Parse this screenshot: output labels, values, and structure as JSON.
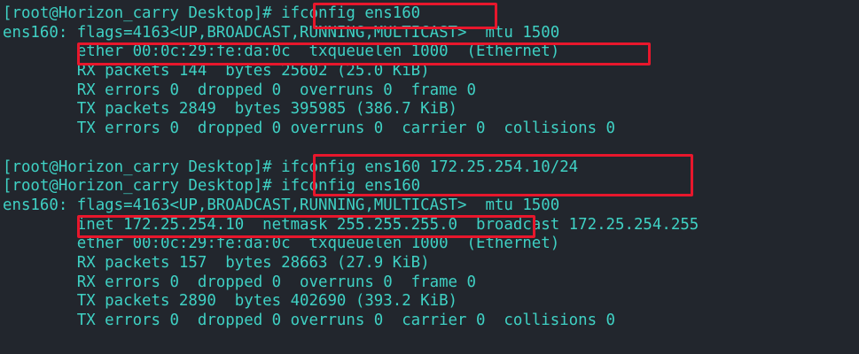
{
  "terminal": {
    "lines": [
      "[root@Horizon_carry Desktop]# ifconfig ens160",
      "ens160: flags=4163<UP,BROADCAST,RUNNING,MULTICAST>  mtu 1500",
      "        ether 00:0c:29:fe:da:0c  txqueuelen 1000  (Ethernet)",
      "        RX packets 144  bytes 25602 (25.0 KiB)",
      "        RX errors 0  dropped 0  overruns 0  frame 0",
      "        TX packets 2849  bytes 395985 (386.7 KiB)",
      "        TX errors 0  dropped 0 overruns 0  carrier 0  collisions 0",
      "",
      "[root@Horizon_carry Desktop]# ifconfig ens160 172.25.254.10/24",
      "[root@Horizon_carry Desktop]# ifconfig ens160",
      "ens160: flags=4163<UP,BROADCAST,RUNNING,MULTICAST>  mtu 1500",
      "        inet 172.25.254.10  netmask 255.255.255.0  broadcast 172.25.254.255",
      "        ether 00:0c:29:fe:da:0c  txqueuelen 1000  (Ethernet)",
      "        RX packets 157  bytes 28663 (27.9 KiB)",
      "        RX errors 0  dropped 0  overruns 0  frame 0",
      "        TX packets 2890  bytes 402690 (393.2 KiB)",
      "        TX errors 0  dropped 0 overruns 0  carrier 0  collisions 0"
    ]
  },
  "colors": {
    "background": "#22262d",
    "text": "#3fd1c4",
    "highlight": "#e8172c"
  }
}
